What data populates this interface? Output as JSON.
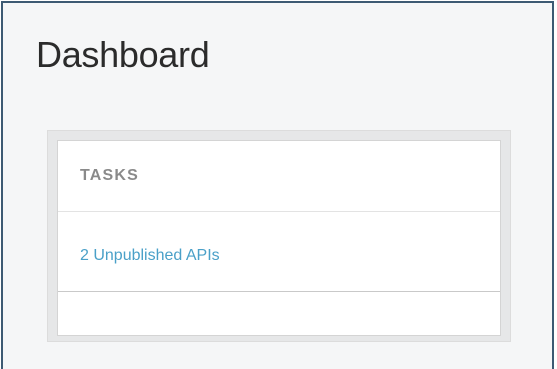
{
  "page": {
    "title": "Dashboard"
  },
  "tasks_widget": {
    "title": "TASKS",
    "items": [
      {
        "label": "2 Unpublished APIs"
      }
    ]
  },
  "colors": {
    "frame_border": "#3d5a73",
    "background": "#f5f6f7",
    "link": "#4aa0c8",
    "heading": "#8a8a8a"
  }
}
